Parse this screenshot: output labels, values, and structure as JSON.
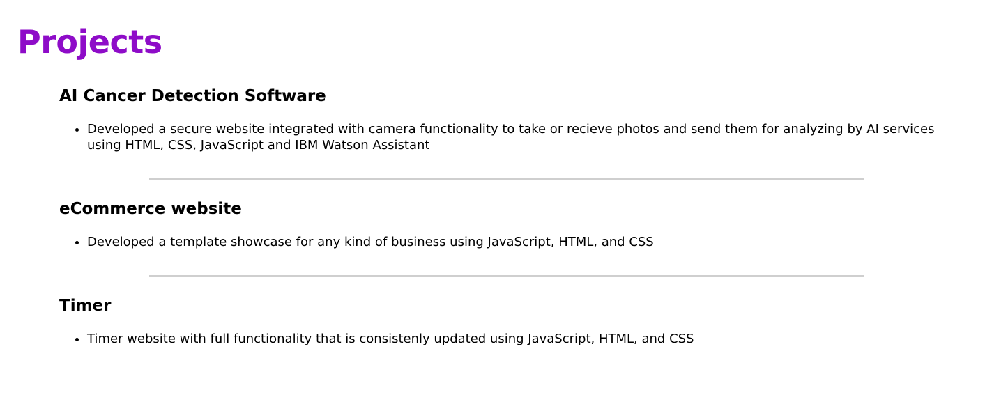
{
  "page": {
    "section_title": "Projects",
    "accent_color": "#8e0cc8"
  },
  "projects": [
    {
      "title": "AI Cancer Detection Software",
      "bullets": [
        "Developed a secure website integrated with camera functionality to take or recieve photos and send them for analyzing by AI services using HTML, CSS, JavaScript and IBM Watson Assistant"
      ]
    },
    {
      "title": "eCommerce website",
      "bullets": [
        "Developed a template showcase for any kind of business using JavaScript, HTML, and CSS"
      ]
    },
    {
      "title": "Timer",
      "bullets": [
        "Timer website with full functionality that is consistenly updated using JavaScript, HTML, and CSS"
      ]
    }
  ]
}
